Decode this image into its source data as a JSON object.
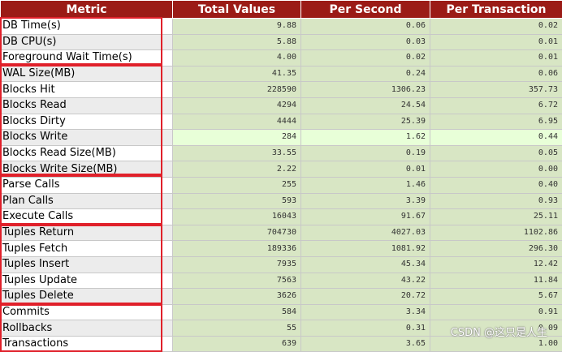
{
  "columns": [
    "Metric",
    "Total Values",
    "Per Second",
    "Per Transaction"
  ],
  "rows": [
    {
      "metric": "DB Time(s)",
      "total": "9.88",
      "per_second": "0.06",
      "per_transaction": "0.02"
    },
    {
      "metric": "DB CPU(s)",
      "total": "5.88",
      "per_second": "0.03",
      "per_transaction": "0.01"
    },
    {
      "metric": "Foreground Wait Time(s)",
      "total": "4.00",
      "per_second": "0.02",
      "per_transaction": "0.01"
    },
    {
      "metric": "WAL Size(MB)",
      "total": "41.35",
      "per_second": "0.24",
      "per_transaction": "0.06"
    },
    {
      "metric": "Blocks Hit",
      "total": "228590",
      "per_second": "1306.23",
      "per_transaction": "357.73"
    },
    {
      "metric": "Blocks Read",
      "total": "4294",
      "per_second": "24.54",
      "per_transaction": "6.72"
    },
    {
      "metric": "Blocks Dirty",
      "total": "4444",
      "per_second": "25.39",
      "per_transaction": "6.95"
    },
    {
      "metric": "Blocks Write",
      "total": "284",
      "per_second": "1.62",
      "per_transaction": "0.44"
    },
    {
      "metric": "Blocks Read Size(MB)",
      "total": "33.55",
      "per_second": "0.19",
      "per_transaction": "0.05"
    },
    {
      "metric": "Blocks Write Size(MB)",
      "total": "2.22",
      "per_second": "0.01",
      "per_transaction": "0.00"
    },
    {
      "metric": "Parse Calls",
      "total": "255",
      "per_second": "1.46",
      "per_transaction": "0.40"
    },
    {
      "metric": "Plan Calls",
      "total": "593",
      "per_second": "3.39",
      "per_transaction": "0.93"
    },
    {
      "metric": "Execute Calls",
      "total": "16043",
      "per_second": "91.67",
      "per_transaction": "25.11"
    },
    {
      "metric": "Tuples Return",
      "total": "704730",
      "per_second": "4027.03",
      "per_transaction": "1102.86"
    },
    {
      "metric": "Tuples Fetch",
      "total": "189336",
      "per_second": "1081.92",
      "per_transaction": "296.30"
    },
    {
      "metric": "Tuples Insert",
      "total": "7935",
      "per_second": "45.34",
      "per_transaction": "12.42"
    },
    {
      "metric": "Tuples Update",
      "total": "7563",
      "per_second": "43.22",
      "per_transaction": "11.84"
    },
    {
      "metric": "Tuples Delete",
      "total": "3626",
      "per_second": "20.72",
      "per_transaction": "5.67"
    },
    {
      "metric": "Commits",
      "total": "584",
      "per_second": "3.34",
      "per_transaction": "0.91"
    },
    {
      "metric": "Rollbacks",
      "total": "55",
      "per_second": "0.31",
      "per_transaction": "0.09"
    },
    {
      "metric": "Transactions",
      "total": "639",
      "per_second": "3.65",
      "per_transaction": "1.00"
    }
  ],
  "watermark": "CSDN @这只是人生",
  "colors": {
    "header_bg": "#9b1b16",
    "value_bg": "#d8e6c4",
    "highlight_bg": "#e8ffd8",
    "group_border": "#e0202a"
  }
}
